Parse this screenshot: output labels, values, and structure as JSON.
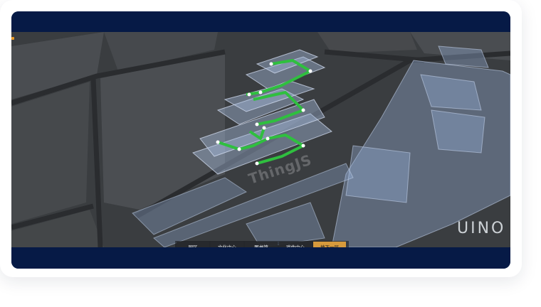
{
  "viewer": {
    "watermark": "ThingJS",
    "brand": "UINO 优",
    "tabs": [
      {
        "label": "园区",
        "active": false
      },
      {
        "label": "文化中心",
        "active": false
      },
      {
        "label": "图书馆",
        "active": false
      },
      {
        "label": "戏曲中心",
        "active": false
      },
      {
        "label": "地下一层",
        "active": true
      }
    ]
  },
  "colors": {
    "frame_band": "#061a46",
    "scene_bg": "#3a3d40",
    "route": "#2fbf3f",
    "active_tab": "#d79a3c",
    "building_glass": "#9fb4d6"
  }
}
